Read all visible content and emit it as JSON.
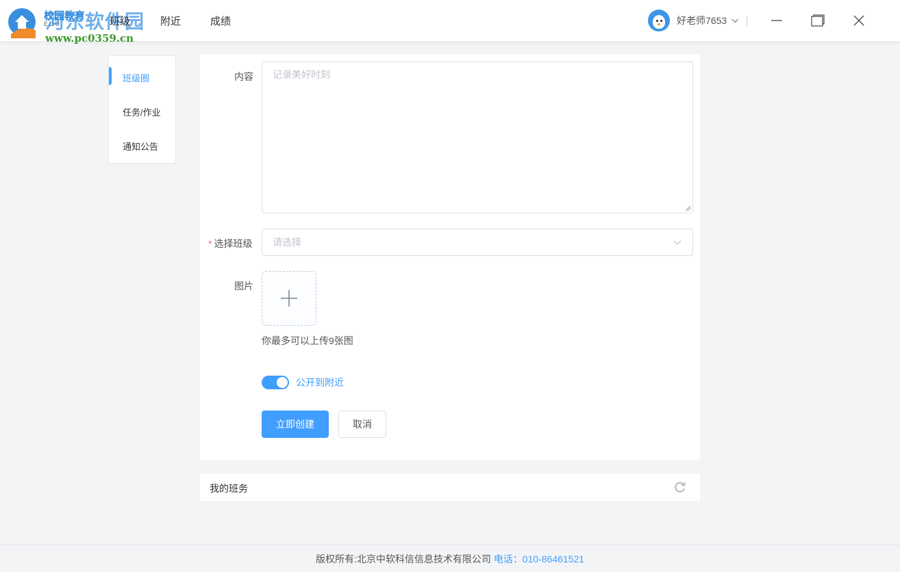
{
  "header": {
    "logo_brand": "校园教育",
    "logo_sub": "EDU",
    "watermark": "河东软件园",
    "watermark_url": "www.pc0359.cn",
    "nav": [
      {
        "label": "班级"
      },
      {
        "label": "附近"
      },
      {
        "label": "成绩"
      }
    ],
    "user_name": "好老师7653"
  },
  "sidebar": {
    "items": [
      {
        "label": "班级圈",
        "active": true
      },
      {
        "label": "任务/作业",
        "active": false
      },
      {
        "label": "通知公告",
        "active": false
      }
    ]
  },
  "form": {
    "content_label": "内容",
    "content_placeholder": "记录美好时刻",
    "class_label": "选择班级",
    "class_required_mark": "*",
    "class_placeholder": "请选择",
    "image_label": "图片",
    "upload_tip": "你最多可以上传9张图",
    "public_toggle_label": "公开到附近",
    "public_toggle_on": true,
    "create_button": "立即创建",
    "cancel_button": "取消"
  },
  "my_class": {
    "title": "我的班务"
  },
  "footer": {
    "copyright": "版权所有:北京中软科信信息技术有限公司",
    "phone": "电话：010-86461521"
  },
  "colors": {
    "accent": "#409eff",
    "required": "#f56c6c"
  }
}
